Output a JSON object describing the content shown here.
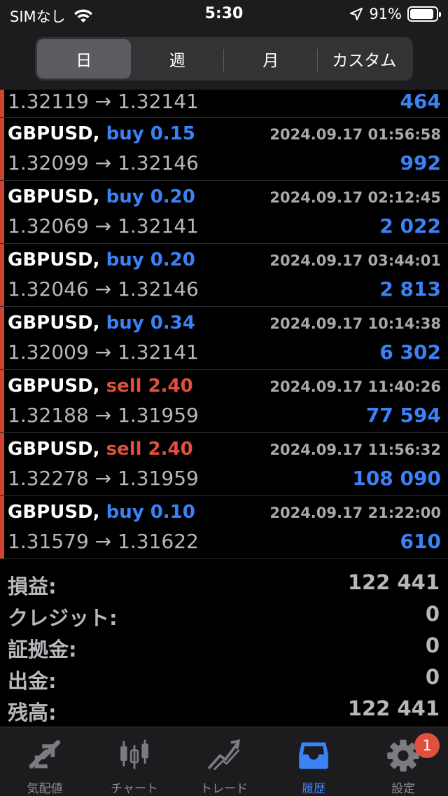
{
  "status_bar": {
    "carrier": "SIMなし",
    "time": "5:30",
    "battery": "91%",
    "battery_level": 0.91
  },
  "period_tabs": [
    {
      "label": "日",
      "active": true
    },
    {
      "label": "週",
      "active": false
    },
    {
      "label": "月",
      "active": false
    },
    {
      "label": "カスタム",
      "active": false
    }
  ],
  "deals": [
    {
      "symbol": "",
      "type": "",
      "side": "",
      "time": "",
      "open": "1.32119",
      "close": "1.32141",
      "profit": "464"
    },
    {
      "symbol": "GBPUSD,",
      "type": "buy 0.15",
      "side": "buy",
      "time": "2024.09.17 01:56:58",
      "open": "1.32099",
      "close": "1.32146",
      "profit": "992"
    },
    {
      "symbol": "GBPUSD,",
      "type": "buy 0.20",
      "side": "buy",
      "time": "2024.09.17 02:12:45",
      "open": "1.32069",
      "close": "1.32141",
      "profit": "2 022"
    },
    {
      "symbol": "GBPUSD,",
      "type": "buy 0.20",
      "side": "buy",
      "time": "2024.09.17 03:44:01",
      "open": "1.32046",
      "close": "1.32146",
      "profit": "2 813"
    },
    {
      "symbol": "GBPUSD,",
      "type": "buy 0.34",
      "side": "buy",
      "time": "2024.09.17 10:14:38",
      "open": "1.32009",
      "close": "1.32141",
      "profit": "6 302"
    },
    {
      "symbol": "GBPUSD,",
      "type": "sell 2.40",
      "side": "sell",
      "time": "2024.09.17 11:40:26",
      "open": "1.32188",
      "close": "1.31959",
      "profit": "77 594"
    },
    {
      "symbol": "GBPUSD,",
      "type": "sell 2.40",
      "side": "sell",
      "time": "2024.09.17 11:56:32",
      "open": "1.32278",
      "close": "1.31959",
      "profit": "108 090"
    },
    {
      "symbol": "GBPUSD,",
      "type": "buy 0.10",
      "side": "buy",
      "time": "2024.09.17 21:22:00",
      "open": "1.31579",
      "close": "1.31622",
      "profit": "610"
    }
  ],
  "arrow": "→",
  "summary": [
    {
      "label": "損益:",
      "value": "122 441"
    },
    {
      "label": "クレジット:",
      "value": "0"
    },
    {
      "label": "証拠金:",
      "value": "0"
    },
    {
      "label": "出金:",
      "value": "0"
    },
    {
      "label": "残高:",
      "value": "122 441"
    }
  ],
  "tab_bar": [
    {
      "label": "気配値",
      "icon": "quotes-arrows-icon",
      "active": false
    },
    {
      "label": "チャート",
      "icon": "candlestick-chart-icon",
      "active": false
    },
    {
      "label": "トレード",
      "icon": "trade-line-icon",
      "active": false
    },
    {
      "label": "履歴",
      "icon": "history-tray-icon",
      "active": true
    },
    {
      "label": "設定",
      "icon": "gear-icon",
      "active": false,
      "badge": "1"
    }
  ],
  "colors": {
    "buy": "#3b82f6",
    "sell": "#e0503c",
    "accent": "#3b82f6",
    "row_marker": "#d0432f"
  }
}
